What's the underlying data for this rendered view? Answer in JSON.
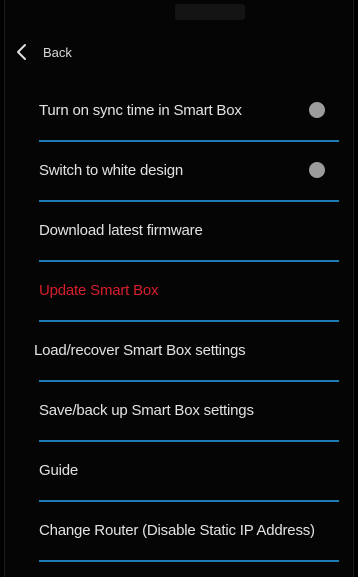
{
  "header": {
    "back_label": "Back"
  },
  "menu": {
    "items": [
      {
        "label": "Turn on sync time in Smart Box",
        "toggle": true
      },
      {
        "label": "Switch to white design",
        "toggle": true
      },
      {
        "label": "Download latest firmware"
      },
      {
        "label": "Update Smart Box",
        "color": "#d61f2c"
      },
      {
        "label": "Load/recover Smart Box settings"
      },
      {
        "label": "Save/back up Smart Box settings"
      },
      {
        "label": "Guide"
      },
      {
        "label": "Change Router (Disable Static IP Address)"
      }
    ]
  },
  "colors": {
    "background": "#050505",
    "divider": "#1f7bb8",
    "danger": "#d61f2c",
    "toggle_off": "#9c9c9c"
  }
}
